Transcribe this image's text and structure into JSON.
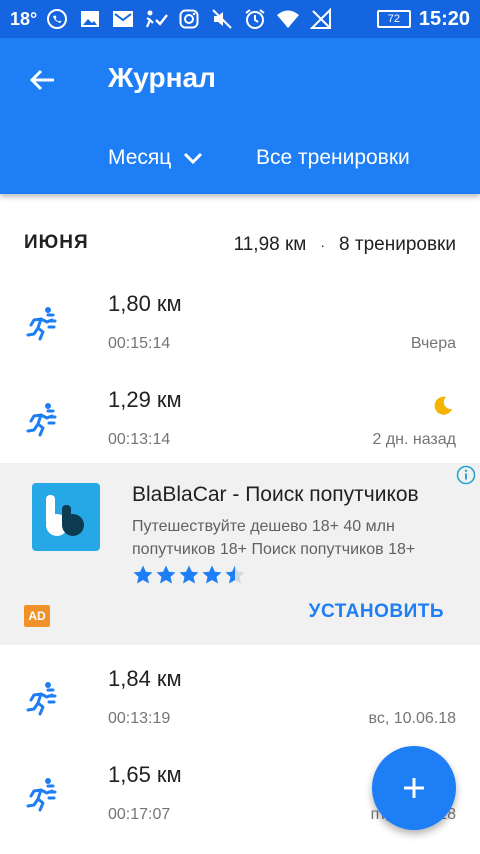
{
  "status_bar": {
    "temperature": "18°",
    "battery": "72",
    "time": "15:20"
  },
  "app_bar": {
    "title": "Журнал",
    "period_filter": "Месяц",
    "type_filter": "Все тренировки"
  },
  "summary": {
    "month": "ИЮНЯ",
    "distance": "11,98 км",
    "separator": "·",
    "count": "8 тренировки"
  },
  "workouts": [
    {
      "distance": "1,80 км",
      "duration": "00:15:14",
      "date": "Вчера",
      "night": false
    },
    {
      "distance": "1,29 км",
      "duration": "00:13:14",
      "date": "2 дн. назад",
      "night": true
    },
    {
      "distance": "1,84 км",
      "duration": "00:13:19",
      "date": "вс, 10.06.18",
      "night": false
    },
    {
      "distance": "1,65 км",
      "duration": "00:17:07",
      "date": "пт, 08.06.18",
      "night": false
    }
  ],
  "ad": {
    "title": "BlaBlaCar - Поиск попутчиков",
    "description": "Путешествуйте дешево 18+ 40 млн попутчиков 18+ Поиск попутчиков 18+",
    "rating": 4.5,
    "badge": "AD",
    "install": "УСТАНОВИТЬ"
  },
  "colors": {
    "status_bar": "#1565e0",
    "app_bar": "#1e7ef5",
    "accent": "#1e7ef5",
    "ad_badge": "#f0922a",
    "moon": "#f5b400"
  },
  "icons": {
    "back": "arrow-left-icon",
    "dropdown": "chevron-down-icon",
    "workout": "runner-icon",
    "night": "moon-icon",
    "info": "info-icon",
    "fab": "plus-icon"
  }
}
